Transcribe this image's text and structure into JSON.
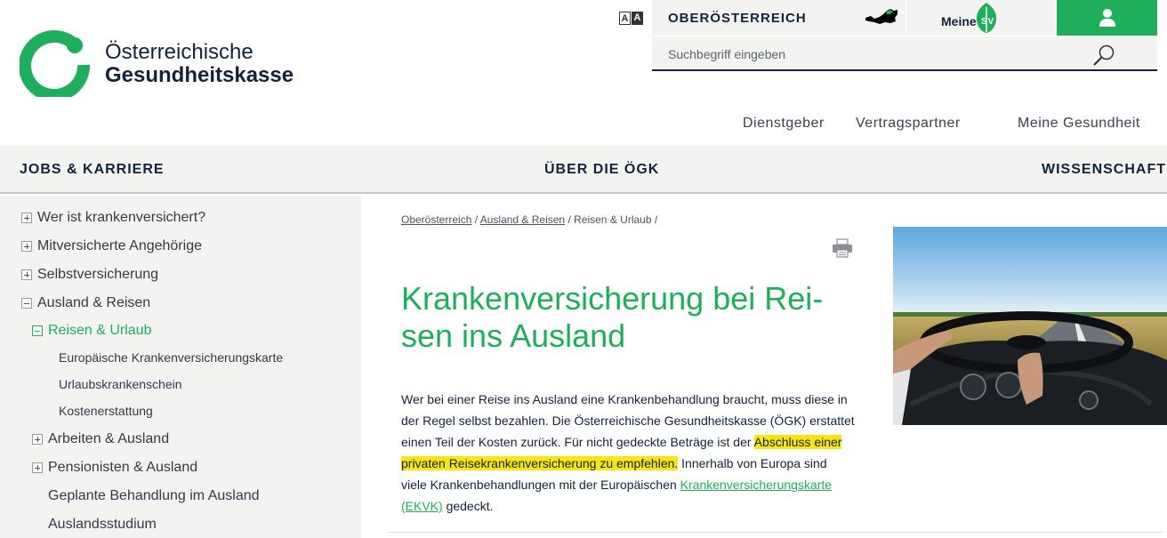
{
  "brand": {
    "line1": "Österreichische",
    "line2": "Gesundheitskasse"
  },
  "header": {
    "region": "OBERÖSTERREICH",
    "meine": "Meine",
    "search_placeholder": "Suchbegriff eingeben",
    "aa_label": "A"
  },
  "topnav": [
    "Dienstgeber",
    "Vertragspartner",
    "Meine Gesundheit"
  ],
  "mainnav": [
    "JOBS & KARRIERE",
    "ÜBER DIE ÖGK",
    "WISSENSCHAFT"
  ],
  "sidebar": {
    "items": [
      "Wer ist krankenversichert?",
      "Mitversicherte Angehörige",
      "Selbstversicherung",
      "Ausland & Reisen",
      "Reisen & Urlaub",
      "Europäische Krankenversicherungskarte",
      "Urlaubskrankenschein",
      "Kostenerstattung",
      "Arbeiten & Ausland",
      "Pensionisten & Ausland",
      "Geplante Behandlung im Ausland",
      "Auslandsstudium"
    ]
  },
  "breadcrumb": {
    "c1": "Oberösterreich",
    "sep": " / ",
    "c2": "Ausland & Reisen",
    "c3": "Reisen & Urlaub",
    "trail": " /"
  },
  "content": {
    "title": "Krankenversicherung bei Rei-sen ins Ausland",
    "p_part1": "Wer bei einer Reise ins Ausland eine Krankenbehandlung braucht, muss diese in der Regel selbst bezahlen. Die Österreichische Gesundheitskasse (ÖGK) erstattet einen Teil der Kosten zurück. Für nicht gedeckte Beträge ist der ",
    "p_highlight": "Abschluss einer privaten Reisekrankenversicherung zu empfehlen.",
    "p_part2": " Innerhalb von Europa sind viele Krankenbehandlungen mit der Europäischen ",
    "p_link": "Krankenversicherungskarte (EKVK)",
    "p_part3": " gedeckt."
  },
  "colors": {
    "brand_green": "#1fae5c",
    "navy": "#14233a",
    "nav_bg": "#f3f3f1",
    "highlight": "#f9e510"
  }
}
